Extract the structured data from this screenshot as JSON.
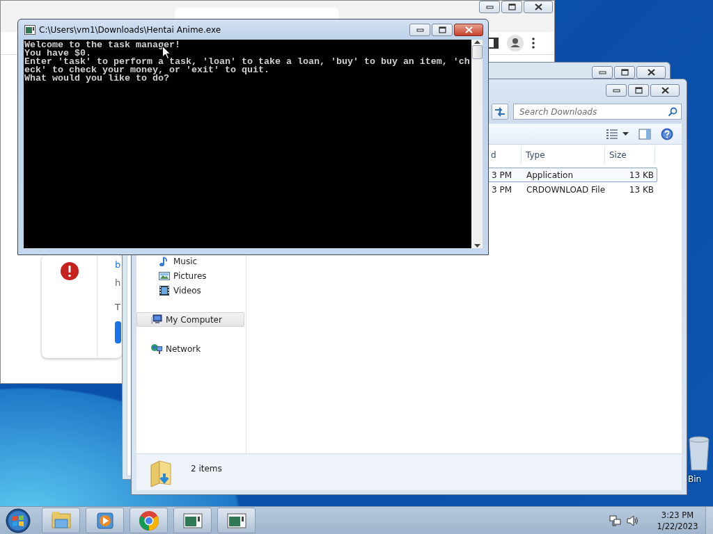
{
  "browser_window": {
    "download_item": {
      "title": "b",
      "url": "h",
      "note": "T"
    }
  },
  "explorer_window": {
    "search": {
      "placeholder": "Search Downloads"
    },
    "columns": [
      "d",
      "Type",
      "Size"
    ],
    "files": [
      {
        "date": "3 PM",
        "type": "Application",
        "size": "13 KB",
        "selected": true
      },
      {
        "date": "3 PM",
        "type": "CRDOWNLOAD File",
        "size": "13 KB",
        "selected": false
      }
    ],
    "nav": [
      {
        "kind": "music",
        "label": "Music",
        "selected": false
      },
      {
        "kind": "pictures",
        "label": "Pictures",
        "selected": false
      },
      {
        "kind": "videos",
        "label": "Videos",
        "selected": false
      },
      {
        "kind": "computer",
        "label": "My Computer",
        "selected": true
      },
      {
        "kind": "network",
        "label": "Network",
        "selected": false
      }
    ],
    "status": "2 items"
  },
  "console_window": {
    "title": "C:\\Users\\vm1\\Downloads\\Hentai Anime.exe",
    "lines": [
      "Welcome to the task manager!",
      "You have $0.",
      "Enter 'task' to perform a task, 'loan' to take a loan, 'buy' to buy an item, 'ch",
      "eck' to check your money, or 'exit' to quit.",
      "What would you like to do?"
    ]
  },
  "desktop": {
    "icon_label": "Bin"
  },
  "taskbar": {
    "buttons": [
      {
        "kind": "explorer"
      },
      {
        "kind": "media"
      },
      {
        "kind": "chrome"
      },
      {
        "kind": "console"
      },
      {
        "kind": "console"
      }
    ],
    "clock": {
      "time": "3:23 PM",
      "date": "1/22/2023"
    }
  }
}
